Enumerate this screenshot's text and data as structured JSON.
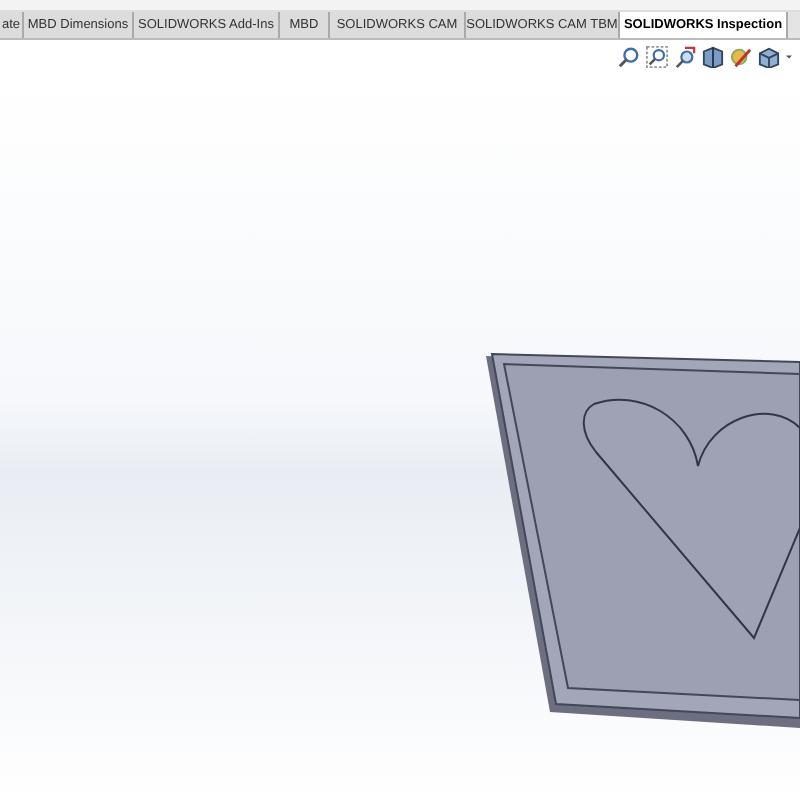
{
  "tabs": [
    {
      "label": "ate",
      "selected": false
    },
    {
      "label": "MBD Dimensions",
      "selected": false
    },
    {
      "label": "SOLIDWORKS Add-Ins",
      "selected": false
    },
    {
      "label": "MBD",
      "selected": false
    },
    {
      "label": "SOLIDWORKS CAM",
      "selected": false
    },
    {
      "label": "SOLIDWORKS CAM TBM",
      "selected": false
    },
    {
      "label": "SOLIDWORKS Inspection",
      "selected": true
    }
  ],
  "toolbar": {
    "tools": [
      {
        "kind": "zoom"
      },
      {
        "kind": "zoom-area"
      },
      {
        "kind": "previous"
      },
      {
        "kind": "section"
      },
      {
        "kind": "dynamic"
      },
      {
        "kind": "display"
      }
    ]
  }
}
